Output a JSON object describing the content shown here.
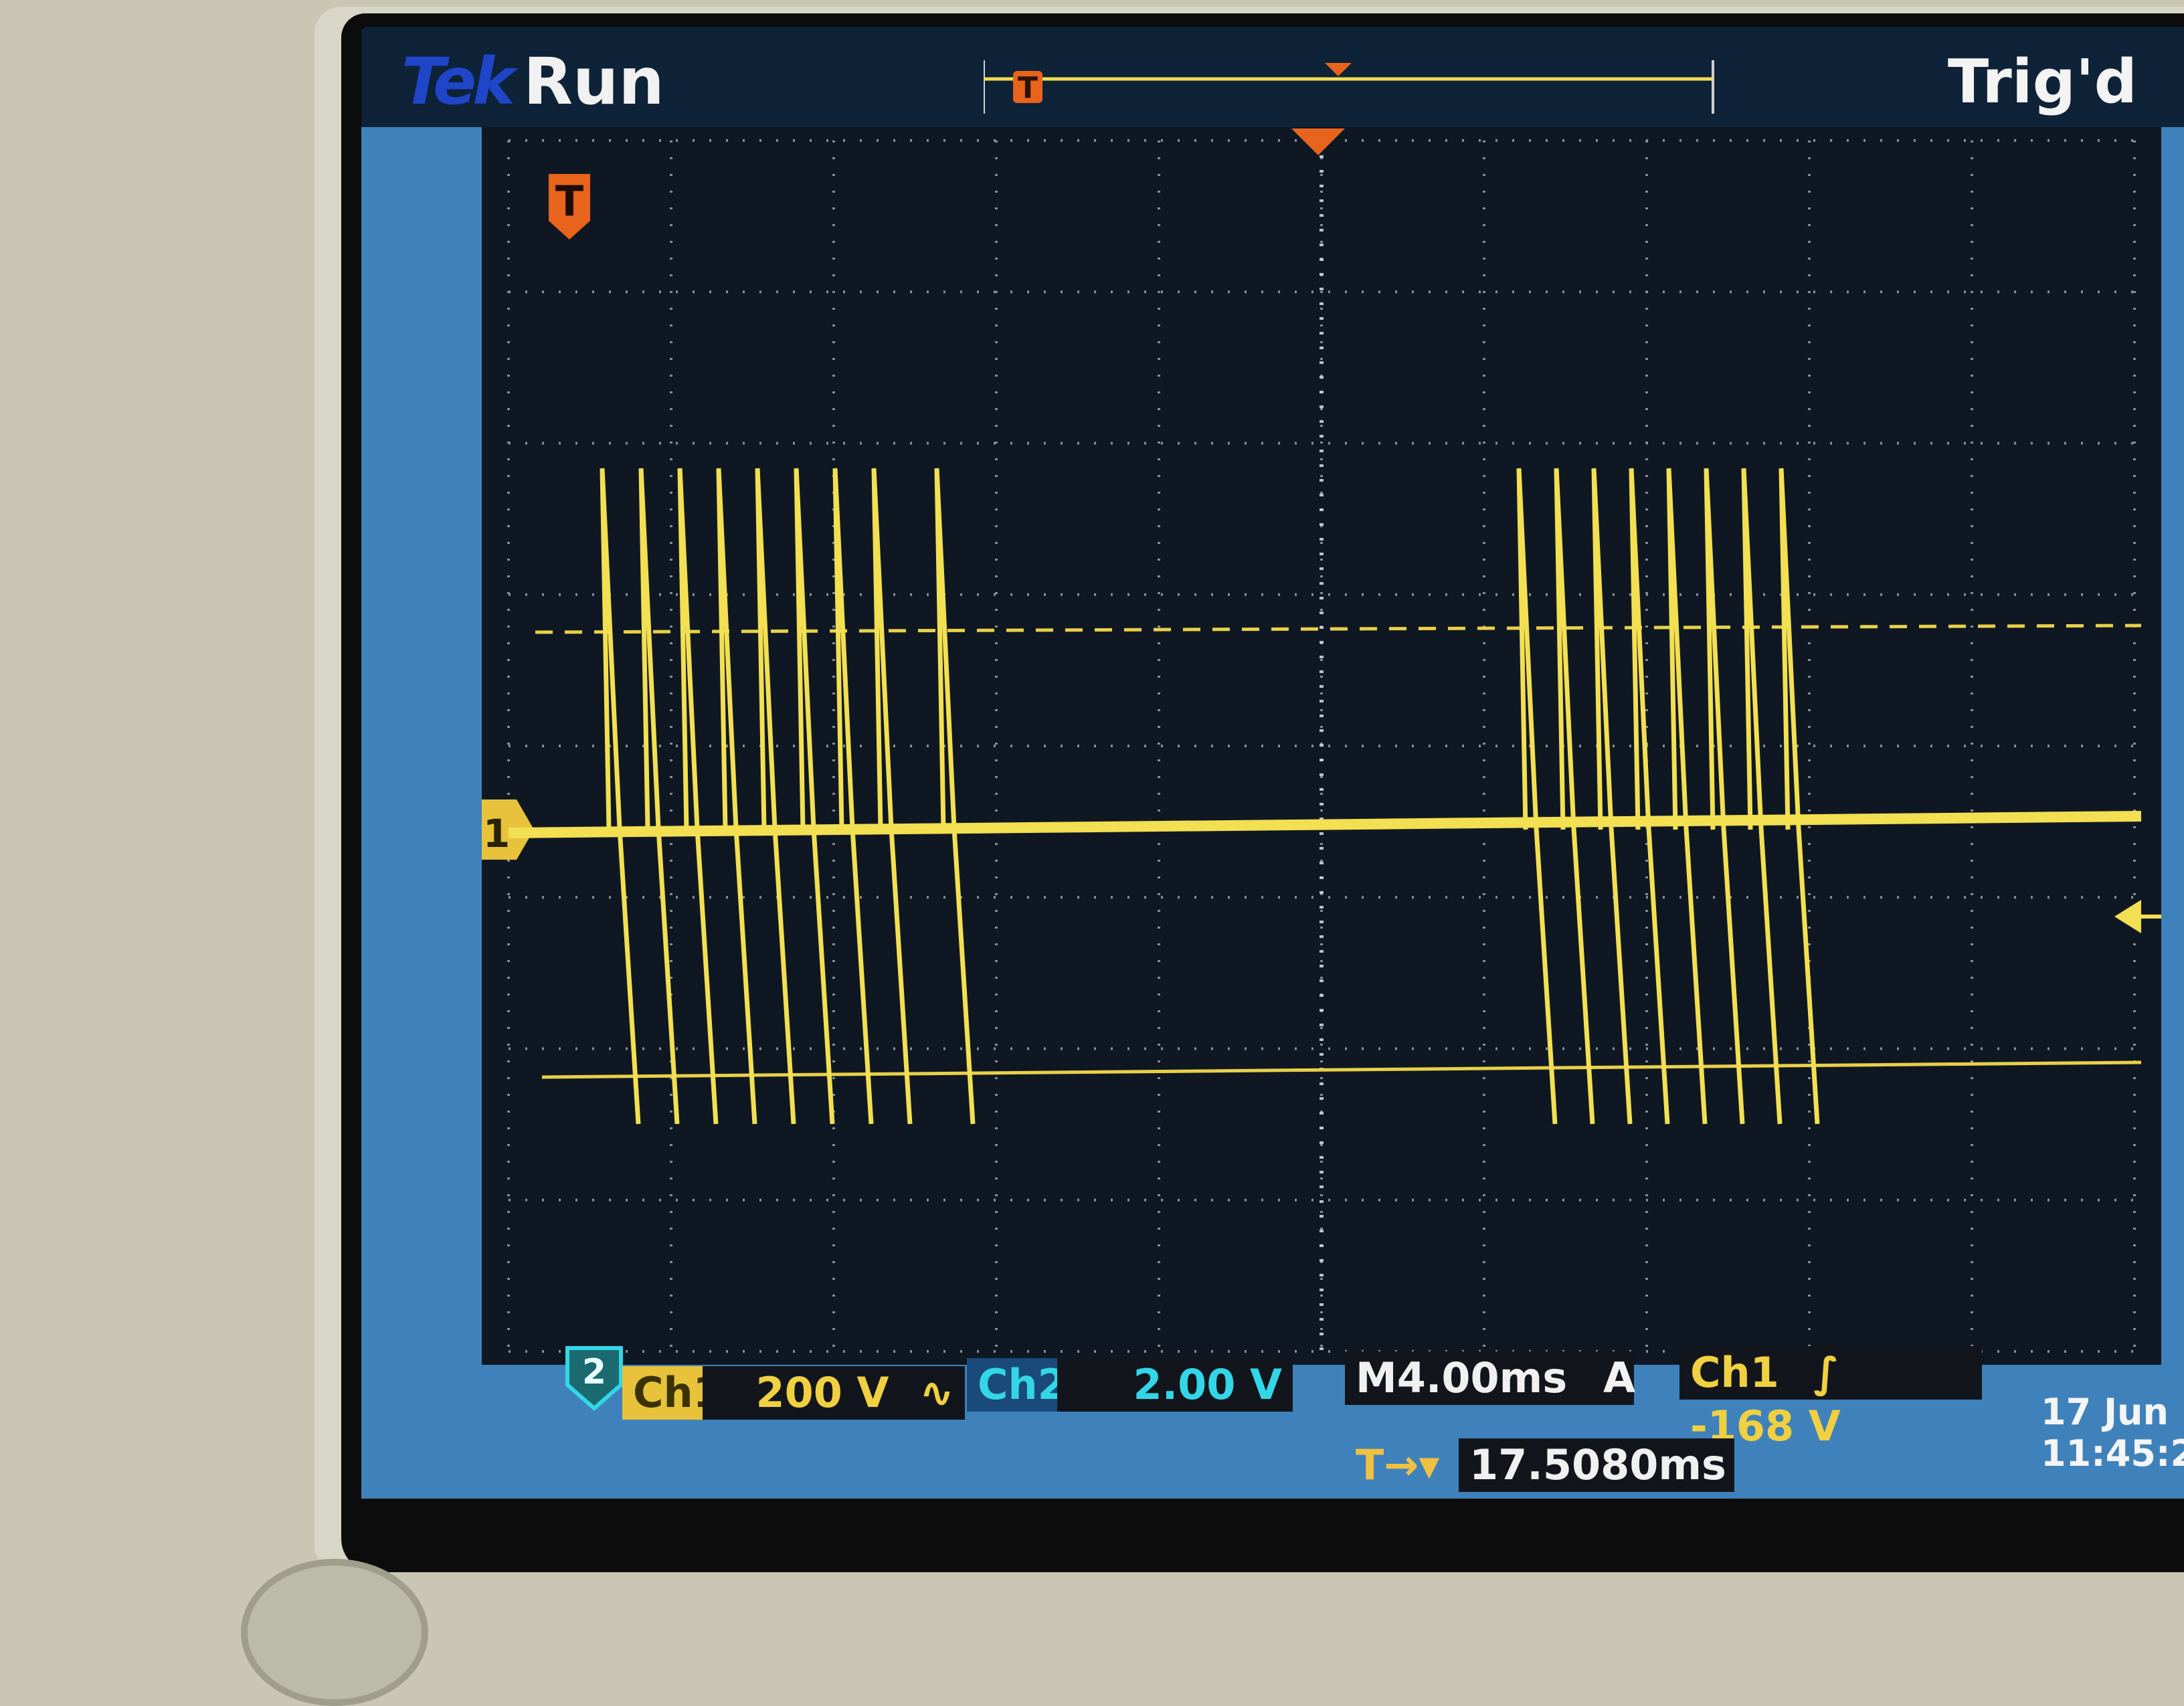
{
  "header": {
    "brand": "Tek",
    "run_state": "Run",
    "trigger_status": "Trig'd"
  },
  "markers": {
    "trigger_marker": "T",
    "channel1_marker": "1",
    "channel2_marker": "2"
  },
  "status": {
    "ch1_label": "Ch1",
    "ch1_scale": "200 V",
    "ch1_coupling_symbol": "∿",
    "ch2_label": "Ch2",
    "ch2_scale": "2.00 V",
    "horizontal_label": "M",
    "horizontal_scale": "4.00ms",
    "trigger_mode": "A",
    "trigger_source": "Ch1",
    "trigger_slope_symbol": "∫",
    "trigger_level": "-168 V",
    "delay_icon": "T→▾",
    "delay": "17.5080ms",
    "date": "17 Jun",
    "time": "11:45:2"
  },
  "colors": {
    "trace": "#f2df52",
    "ch2": "#33d6e6",
    "trigger": "#e8631c",
    "screen_bg": "#0f1822",
    "status_bar": "#3f82bb"
  },
  "waveform": {
    "burst1_pulses": 9,
    "burst2_pulses": 8
  }
}
